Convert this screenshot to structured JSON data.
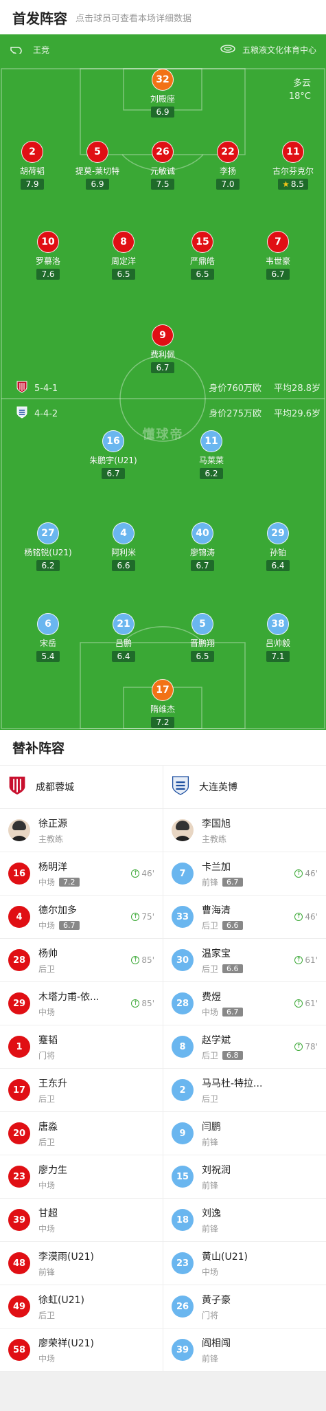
{
  "header": {
    "title": "首发阵容",
    "subtitle": "点击球员可查看本场详细数据"
  },
  "pitch": {
    "referee": "王竞",
    "venue": "五粮液文化体育中心",
    "weather": "多云",
    "temperature": "18°C",
    "watermark": "懂球帝",
    "home": {
      "formation": "5-4-1",
      "value": "身价760万欧",
      "age": "平均28.8岁"
    },
    "away": {
      "formation": "4-4-2",
      "value": "身价275万欧",
      "age": "平均29.6岁"
    }
  },
  "starters": [
    {
      "num": "32",
      "name": "刘殿座",
      "rating": "6.9",
      "color": "orange"
    },
    {
      "num": "2",
      "name": "胡荷韬",
      "rating": "7.9",
      "color": "red",
      "goal": true
    },
    {
      "num": "5",
      "name": "提莫-莱切特",
      "rating": "6.9",
      "color": "red",
      "sub": "85'"
    },
    {
      "num": "26",
      "name": "元敏诚",
      "rating": "7.5",
      "color": "red",
      "goal": true
    },
    {
      "num": "22",
      "name": "李扬",
      "rating": "7.0",
      "color": "red"
    },
    {
      "num": "11",
      "name": "古尔芬克尔",
      "rating": "8.5",
      "color": "red",
      "goal": true,
      "star": true
    },
    {
      "num": "10",
      "name": "罗慕洛",
      "rating": "7.6",
      "color": "red",
      "sub": "75'"
    },
    {
      "num": "8",
      "name": "周定洋",
      "rating": "6.5",
      "color": "red",
      "captain": true
    },
    {
      "num": "15",
      "name": "严鼎皓",
      "rating": "6.5",
      "color": "red",
      "yellow": true,
      "sub": "46'"
    },
    {
      "num": "7",
      "name": "韦世豪",
      "rating": "6.7",
      "color": "red",
      "sub": "85'"
    },
    {
      "num": "9",
      "name": "费利佩",
      "rating": "6.7",
      "color": "red"
    },
    {
      "num": "16",
      "name": "朱鹏宇(U21)",
      "rating": "6.7",
      "color": "blue",
      "yellow": true,
      "sub": "61'"
    },
    {
      "num": "11",
      "name": "马莱莱",
      "rating": "6.2",
      "color": "blue",
      "sub": "46'"
    },
    {
      "num": "27",
      "name": "杨铭锐(U21)",
      "rating": "6.2",
      "color": "blue",
      "yellow": true,
      "sub": "46'"
    },
    {
      "num": "4",
      "name": "阿利米",
      "rating": "6.6",
      "color": "blue"
    },
    {
      "num": "40",
      "name": "廖锦涛",
      "rating": "6.7",
      "color": "blue"
    },
    {
      "num": "29",
      "name": "孙铂",
      "rating": "6.4",
      "color": "blue",
      "yellow": true,
      "sub": "61'"
    },
    {
      "num": "6",
      "name": "宋岳",
      "rating": "5.4",
      "color": "blue",
      "red": true
    },
    {
      "num": "21",
      "name": "吕鹏",
      "rating": "6.4",
      "color": "blue",
      "captain": true
    },
    {
      "num": "5",
      "name": "晋鹏翔",
      "rating": "6.5",
      "color": "blue"
    },
    {
      "num": "38",
      "name": "吕帅毅",
      "rating": "7.1",
      "color": "blue",
      "sub": "78'"
    },
    {
      "num": "17",
      "name": "隋维杰",
      "rating": "7.2",
      "color": "orange"
    }
  ],
  "subs": {
    "title": "替补阵容",
    "home": {
      "team": "成都蓉城",
      "coach": {
        "name": "徐正源",
        "role": "主教练"
      },
      "players": [
        {
          "num": "16",
          "name": "杨明洋",
          "pos": "中场",
          "rating": "7.2",
          "in": "46'"
        },
        {
          "num": "4",
          "name": "德尔加多",
          "pos": "中场",
          "rating": "6.7",
          "in": "75'"
        },
        {
          "num": "28",
          "name": "杨帅",
          "pos": "后卫",
          "in": "85'"
        },
        {
          "num": "29",
          "name": "木塔力甫-依...",
          "pos": "中场",
          "in": "85'"
        },
        {
          "num": "1",
          "name": "蹇韬",
          "pos": "门将"
        },
        {
          "num": "17",
          "name": "王东升",
          "pos": "后卫"
        },
        {
          "num": "20",
          "name": "唐淼",
          "pos": "后卫"
        },
        {
          "num": "23",
          "name": "廖力生",
          "pos": "中场"
        },
        {
          "num": "39",
          "name": "甘超",
          "pos": "中场"
        },
        {
          "num": "48",
          "name": "李漠雨(U21)",
          "pos": "前锋"
        },
        {
          "num": "49",
          "name": "徐虹(U21)",
          "pos": "后卫"
        },
        {
          "num": "58",
          "name": "廖荣祥(U21)",
          "pos": "中场"
        }
      ]
    },
    "away": {
      "team": "大连英博",
      "coach": {
        "name": "李国旭",
        "role": "主教练"
      },
      "players": [
        {
          "num": "7",
          "name": "卡兰加",
          "pos": "前锋",
          "rating": "6.7",
          "in": "46'"
        },
        {
          "num": "33",
          "name": "曹海清",
          "pos": "后卫",
          "rating": "6.6",
          "in": "46'"
        },
        {
          "num": "30",
          "name": "温家宝",
          "pos": "后卫",
          "rating": "6.6",
          "in": "61'"
        },
        {
          "num": "28",
          "name": "费煜",
          "pos": "中场",
          "rating": "6.7",
          "in": "61'"
        },
        {
          "num": "8",
          "name": "赵学斌",
          "pos": "后卫",
          "rating": "6.8",
          "in": "78'"
        },
        {
          "num": "2",
          "name": "马马杜-特拉...",
          "pos": "后卫"
        },
        {
          "num": "9",
          "name": "闫鹏",
          "pos": "前锋"
        },
        {
          "num": "15",
          "name": "刘祝润",
          "pos": "前锋"
        },
        {
          "num": "18",
          "name": "刘逸",
          "pos": "前锋"
        },
        {
          "num": "23",
          "name": "黄山(U21)",
          "pos": "中场"
        },
        {
          "num": "26",
          "name": "黄子豪",
          "pos": "门将"
        },
        {
          "num": "39",
          "name": "阎相闯",
          "pos": "前锋"
        }
      ]
    }
  }
}
